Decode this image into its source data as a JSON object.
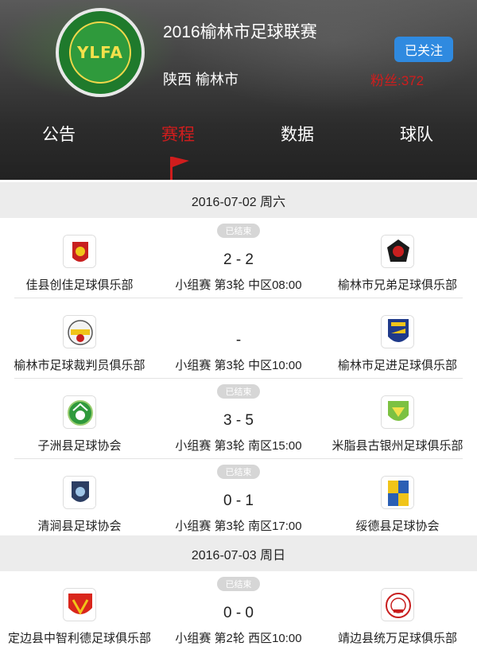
{
  "header": {
    "title": "2016榆林市足球联赛",
    "region": "陕西 榆林市",
    "follow_label": "已关注",
    "fans_label": "粉丝:372",
    "logo_text": "YLFA",
    "logo_icon": "league-logo"
  },
  "tabs": [
    {
      "label": "公告",
      "active": false
    },
    {
      "label": "赛程",
      "active": true
    },
    {
      "label": "数据",
      "active": false
    },
    {
      "label": "球队",
      "active": false
    }
  ],
  "colors": {
    "active_tab": "#d01d1d",
    "follow_button": "#2f8ae0",
    "status_badge": "#d6d6d6",
    "date_bar": "#ececec"
  },
  "days": [
    {
      "date": "2016-07-02 周六",
      "matches": [
        {
          "status": "已结束",
          "home": "佳县创佳足球俱乐部",
          "away": "榆林市兄弟足球俱乐部",
          "score": "2 - 2",
          "info": "小组赛 第3轮 中区08:00"
        },
        {
          "status": "",
          "home": "榆林市足球裁判员俱乐部",
          "away": "榆林市足进足球俱乐部",
          "score": "-",
          "info": "小组赛 第3轮 中区10:00"
        },
        {
          "status": "已结束",
          "home": "子洲县足球协会",
          "away": "米脂县古银州足球俱乐部",
          "score": "3 - 5",
          "info": "小组赛 第3轮 南区15:00"
        },
        {
          "status": "已结束",
          "home": "清涧县足球协会",
          "away": "绥德县足球协会",
          "score": "0 - 1",
          "info": "小组赛 第3轮 南区17:00"
        }
      ]
    },
    {
      "date": "2016-07-03 周日",
      "matches": [
        {
          "status": "已结束",
          "home": "定边县中智利德足球俱乐部",
          "away": "靖边县统万足球俱乐部",
          "score": "0 - 0",
          "info": "小组赛 第2轮 西区10:00"
        }
      ]
    }
  ]
}
